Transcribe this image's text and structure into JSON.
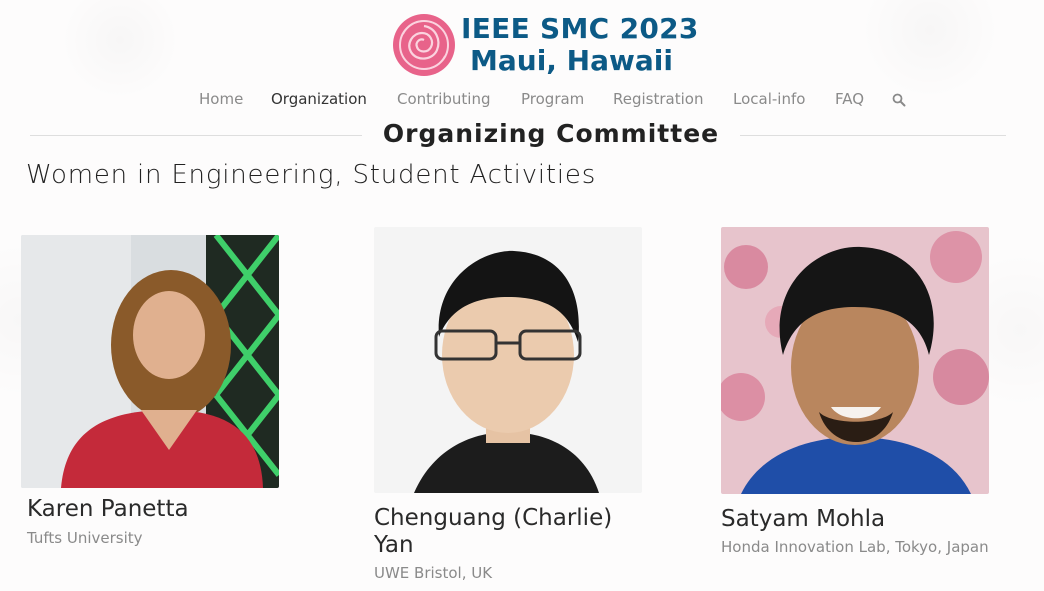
{
  "header": {
    "logo_line1": "IEEE SMC 2023",
    "logo_line2": "Maui, Hawaii",
    "brand_color": "#0c5a86",
    "rose_color": "#e8638a"
  },
  "nav": {
    "items": [
      {
        "label": "Home",
        "active": false
      },
      {
        "label": "Organization",
        "active": true
      },
      {
        "label": "Contributing",
        "active": false
      },
      {
        "label": "Program",
        "active": false
      },
      {
        "label": "Registration",
        "active": false
      },
      {
        "label": "Local-info",
        "active": false
      },
      {
        "label": "FAQ",
        "active": false
      }
    ],
    "search_icon": "search-icon"
  },
  "page": {
    "title": "Organizing Committee",
    "section": "Women in Engineering, Student Activities"
  },
  "members": [
    {
      "name": "Karen Panetta",
      "affiliation": "Tufts University"
    },
    {
      "name_line1": "Chenguang (Charlie)",
      "name_line2": "Yan",
      "affiliation": "UWE Bristol, UK"
    },
    {
      "name": "Satyam Mohla",
      "affiliation": "Honda Innovation Lab, Tokyo, Japan"
    }
  ]
}
